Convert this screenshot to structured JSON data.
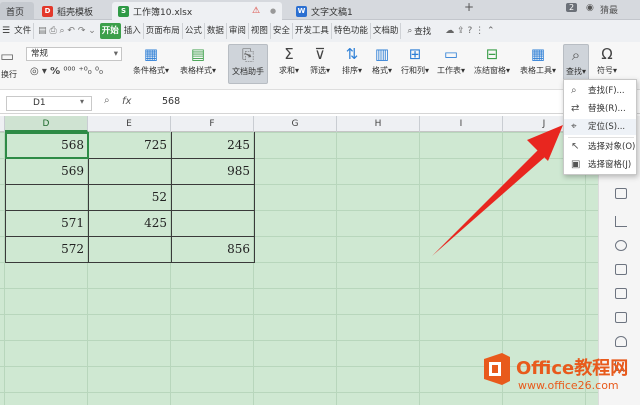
{
  "tabs": [
    {
      "label": "首页"
    },
    {
      "label": "稻壳模板"
    },
    {
      "label": "工作簿10.xlsx",
      "warning_icon": "warning-icon"
    },
    {
      "label": "文字文稿1"
    }
  ],
  "window": {
    "user_label": "猜最"
  },
  "menu": {
    "file": "文件",
    "items": [
      "开始",
      "插入",
      "页面布局",
      "公式",
      "数据",
      "审阅",
      "视图",
      "安全",
      "开发工具",
      "特色功能",
      "文档助"
    ],
    "search": "查找"
  },
  "ribbon": {
    "wrap_text": "换行",
    "number_format": "常规",
    "percent": "%",
    "buttons": [
      "条件格式",
      "表格样式",
      "文档助手",
      "求和",
      "筛选",
      "排序",
      "格式",
      "行和列",
      "工作表",
      "冻结窗格",
      "表格工具",
      "查找",
      "符号"
    ]
  },
  "formula_bar": {
    "cell_ref": "D1",
    "fx": "fx",
    "value": "568"
  },
  "columns": [
    "D",
    "E",
    "F",
    "G",
    "H",
    "I",
    "J"
  ],
  "active_column": "D",
  "sheet": {
    "rows": [
      {
        "D": "568",
        "E": "725",
        "F": "245"
      },
      {
        "D": "569",
        "E": "",
        "F": "985"
      },
      {
        "D": "",
        "E": "52",
        "F": ""
      },
      {
        "D": "571",
        "E": "425",
        "F": ""
      },
      {
        "D": "572",
        "E": "",
        "F": "856"
      }
    ]
  },
  "dropdown": {
    "items": [
      {
        "label": "查找(F)...",
        "icon": "search-icon"
      },
      {
        "label": "替换(R)...",
        "icon": "replace-icon"
      },
      {
        "label": "定位(S)...",
        "icon": "locate-icon"
      },
      {
        "label": "选择对象(O)",
        "icon": "cursor-icon"
      },
      {
        "label": "选择窗格(J)",
        "icon": "pane-icon"
      }
    ]
  },
  "watermark": {
    "brand": "Office教程网",
    "url": "www.office26.com"
  },
  "colors": {
    "accent_green": "#3c9f4a",
    "sheet_bg": "#cfe8d2",
    "arrow_red": "#e8261f",
    "brand_orange": "#e85a1c"
  }
}
